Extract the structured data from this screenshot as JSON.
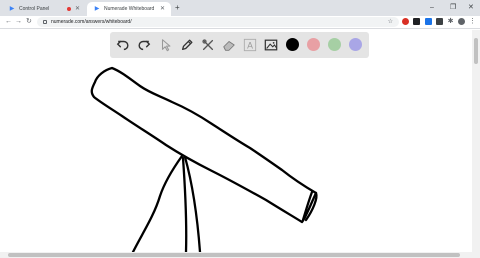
{
  "browser": {
    "tabs": [
      {
        "title": "Control Panel"
      },
      {
        "title": "Numerade Whiteboard"
      }
    ],
    "new_tab": "+",
    "url": "numerade.com/answers/whiteboard/",
    "window_controls": {
      "minimize": "–",
      "maximize": "❐",
      "close": "✕"
    },
    "nav": {
      "back": "←",
      "forward": "→",
      "reload": "↻"
    }
  },
  "whiteboard": {
    "tools": [
      "undo-icon",
      "redo-icon",
      "select-icon",
      "pen-icon",
      "tools-icon",
      "eraser-icon",
      "text-icon",
      "image-icon"
    ],
    "text_tool_label": "A",
    "colors": {
      "black": "#000000",
      "red": "#e8a0a4",
      "green": "#a6cfa4",
      "blue": "#a9a6e6"
    },
    "selected_color": "black"
  },
  "colors": {
    "tab_bar": "#dee1e6",
    "accent": "#3b82f6",
    "toolbar_bg": "#e4e4e4"
  }
}
